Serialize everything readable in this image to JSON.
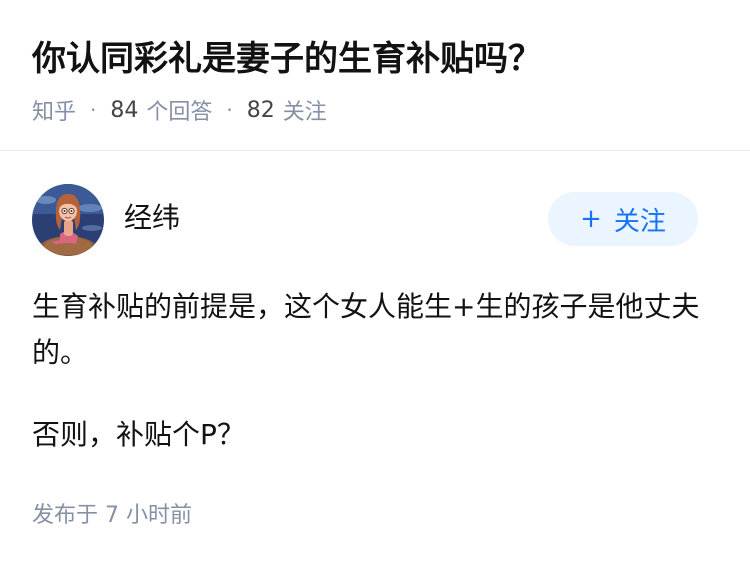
{
  "question": {
    "title": "你认同彩礼是妻子的生育补贴吗？",
    "source": "知乎",
    "separator": "·",
    "answers_count": "84",
    "answers_label": "个回答",
    "followers_count": "82",
    "followers_label": "关注"
  },
  "answer": {
    "author_name": "经纬",
    "follow_plus": "+",
    "follow_label": "关注",
    "paragraphs": [
      "生育补贴的前提是，这个女人能生+生的孩子是他丈夫的。",
      "否则，补贴个P？"
    ],
    "published": "发布于  7 小时前"
  },
  "colors": {
    "accent": "#1772f6",
    "follow_bg": "#ebf5ff",
    "meta": "#8590a6"
  },
  "icons": {
    "avatar": "avatar-cartoon-girl"
  }
}
